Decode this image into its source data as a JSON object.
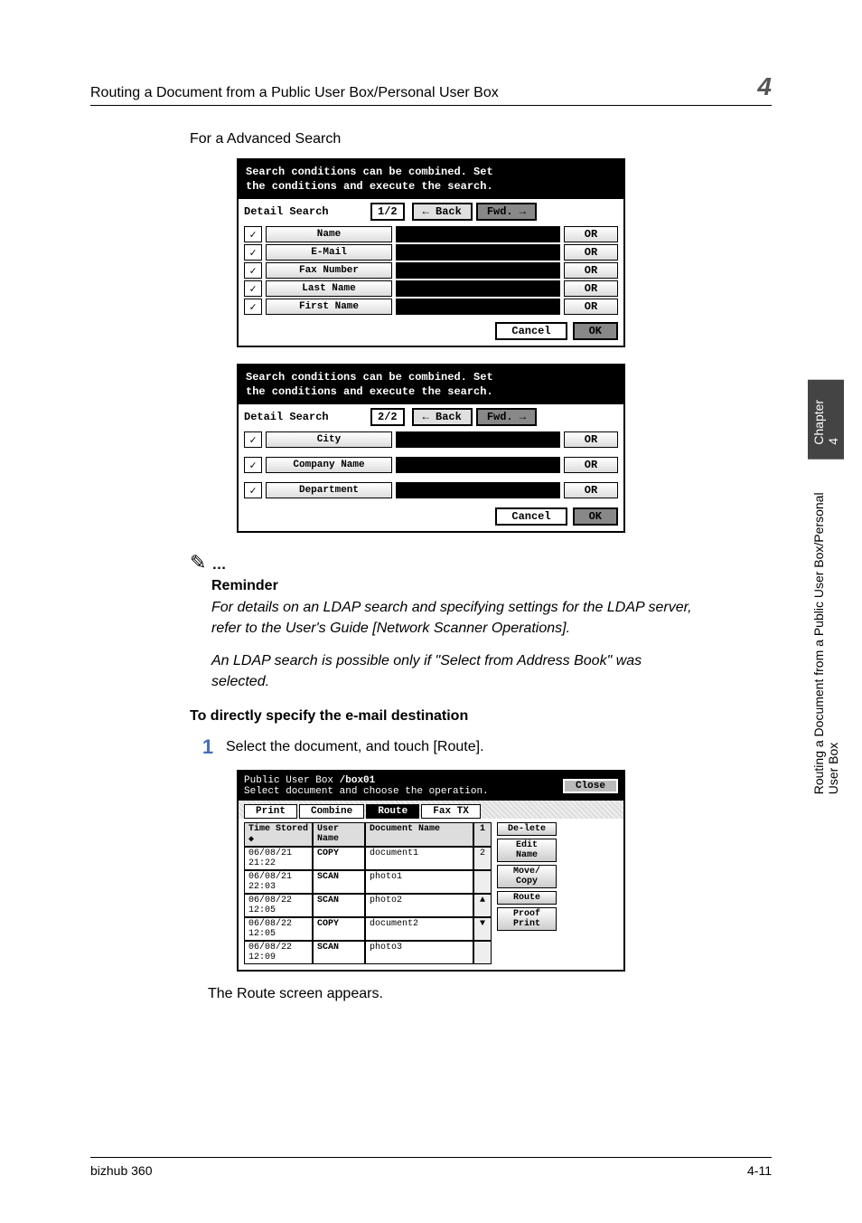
{
  "header": {
    "title": "Routing a Document from a Public User Box/Personal User Box",
    "chapter_num": "4"
  },
  "section_title": "For a Advanced Search",
  "lcd_shared": {
    "header_line1": "Search conditions can be combined. Set",
    "header_line2": "the conditions and execute the search.",
    "label": "Detail Search",
    "back": "← Back",
    "fwd": "Fwd. →",
    "or": "OR",
    "cancel": "Cancel",
    "ok": "OK"
  },
  "lcd1": {
    "page": "1/2",
    "fields": [
      "Name",
      "E-Mail",
      "Fax Number",
      "Last Name",
      "First Name"
    ]
  },
  "lcd2": {
    "page": "2/2",
    "fields": [
      "City",
      "Company Name",
      "Department"
    ]
  },
  "reminder": {
    "title": "Reminder",
    "p1": "For details on an LDAP search and specifying settings for the LDAP server, refer to the User's Guide [Network Scanner Operations].",
    "p2": "An LDAP search is possible only if \"Select from Address Book\" was selected."
  },
  "subsection": "To directly specify the e-mail destination",
  "step1": {
    "num": "1",
    "text": "Select the document, and touch [Route]."
  },
  "box_screen": {
    "title_prefix": "Public User Box",
    "box_name": "/box01",
    "instruction": "Select document and choose the operation.",
    "close": "Close",
    "tabs": [
      "Print",
      "Combine",
      "Route",
      "Fax TX"
    ],
    "active_tab": "Route",
    "cols": {
      "time": "Time Stored ◆",
      "user": "User Name",
      "doc": "Document Name",
      "page_ind_top": "1",
      "page_ind_bot": "2"
    },
    "rows": [
      {
        "time": "06/08/21 21:22",
        "user": "COPY",
        "doc": "document1"
      },
      {
        "time": "06/08/21 22:03",
        "user": "SCAN",
        "doc": "photo1"
      },
      {
        "time": "06/08/22 12:05",
        "user": "SCAN",
        "doc": "photo2"
      },
      {
        "time": "06/08/22 12:05",
        "user": "COPY",
        "doc": "document2"
      },
      {
        "time": "06/08/22 12:09",
        "user": "SCAN",
        "doc": "photo3"
      }
    ],
    "arrows": {
      "up": "▲",
      "down": "▼"
    },
    "side_buttons": [
      "De-lete",
      "Edit Name",
      "Move/ Copy",
      "Route",
      "Proof Print"
    ]
  },
  "result_text": "The Route screen appears.",
  "side_tab": {
    "dark": "Chapter 4",
    "light": "Routing a Document from a Public User Box/Personal User Box"
  },
  "footer": {
    "left": "bizhub 360",
    "right": "4-11"
  }
}
